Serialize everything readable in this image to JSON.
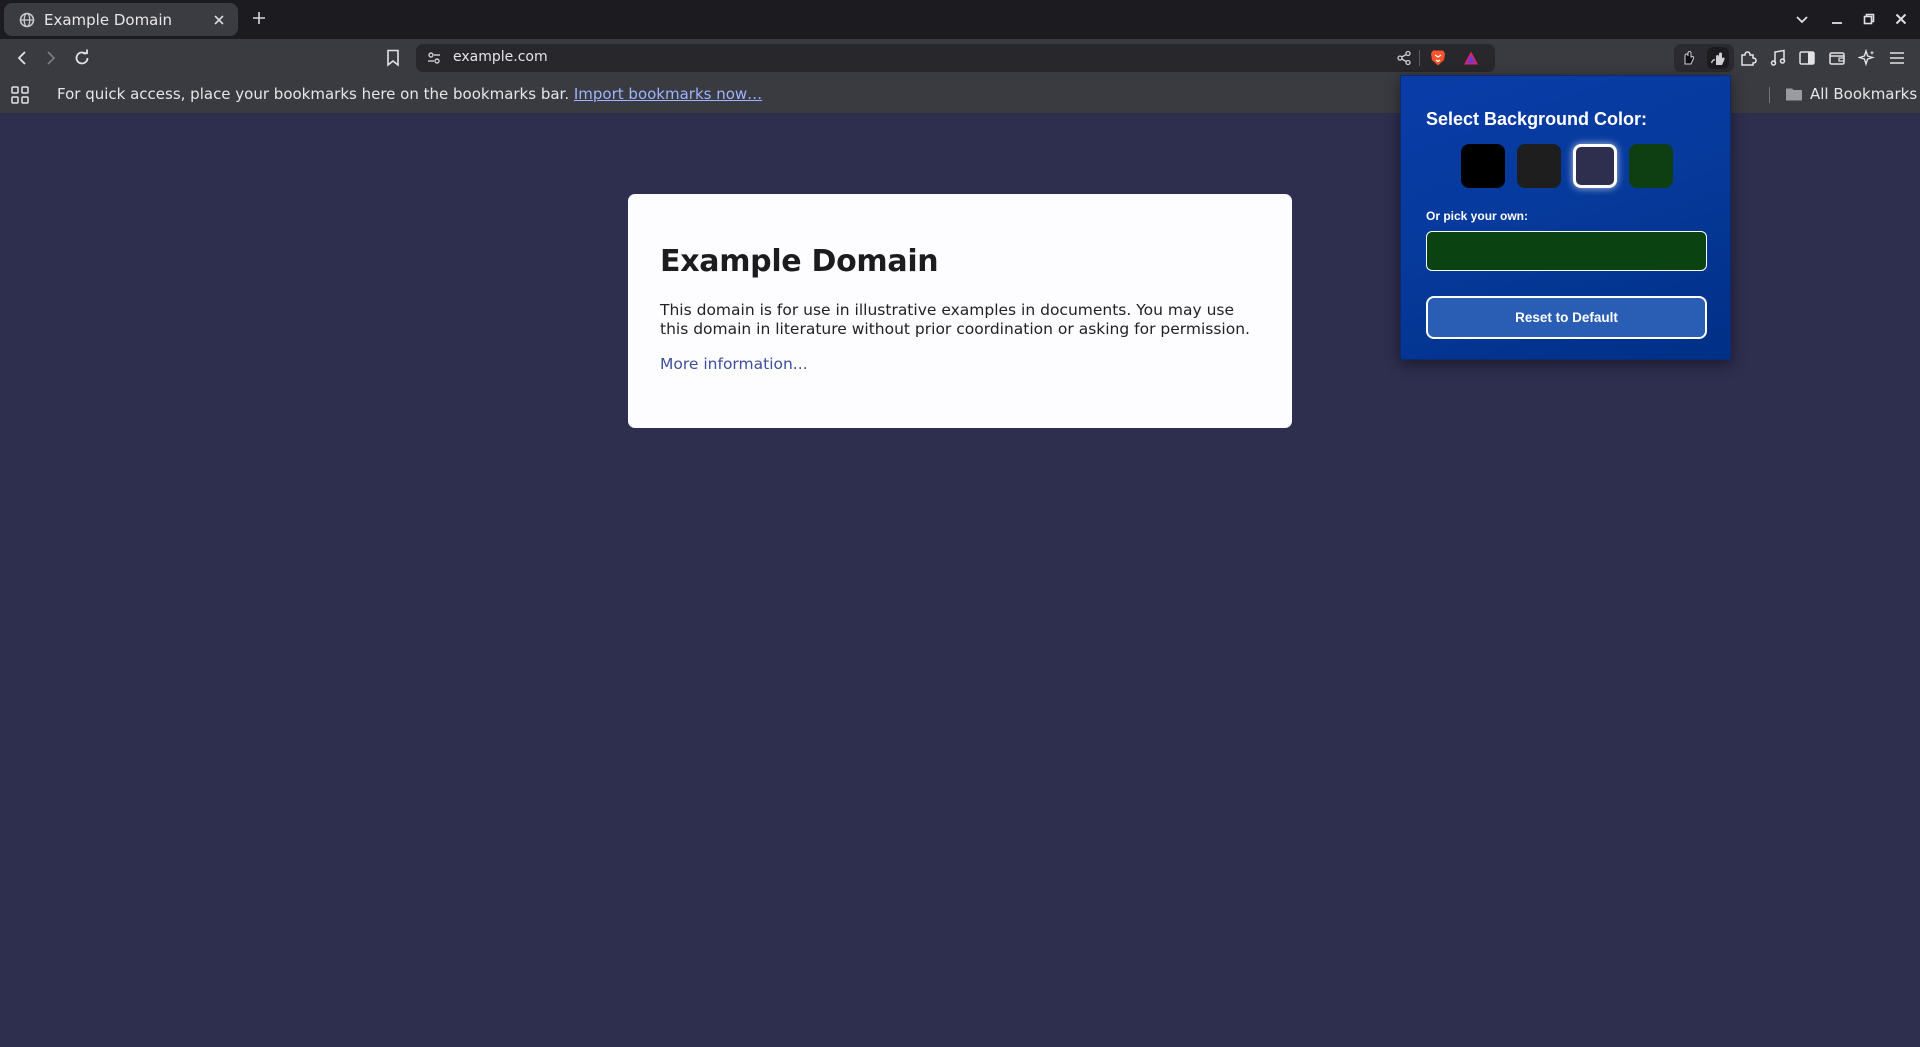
{
  "browser": {
    "tab": {
      "title": "Example Domain"
    },
    "address_bar": {
      "url": "example.com"
    },
    "bookmarks_bar": {
      "message": "For quick access, place your bookmarks here on the bookmarks bar.",
      "import_link": "Import bookmarks now…",
      "all_bookmarks": "All Bookmarks"
    }
  },
  "page": {
    "heading": "Example Domain",
    "paragraph": "This domain is for use in illustrative examples in documents. You may use this domain in literature without prior coordination or asking for permission.",
    "link": "More information..."
  },
  "popup": {
    "title": "Select Background Color:",
    "swatches": [
      {
        "name": "black",
        "color": "#000000"
      },
      {
        "name": "dark-gray",
        "color": "#1e1e1e"
      },
      {
        "name": "navy-slate",
        "color": "#2e2e4f",
        "selected": true
      },
      {
        "name": "dark-green",
        "color": "#0e3f13"
      }
    ],
    "custom_label": "Or pick your own:",
    "custom_color": "#0b4211",
    "reset_label": "Reset to Default"
  },
  "colors": {
    "page_background": "#2e2e4f",
    "popup_background": "#063a9c",
    "link": "#3f4f9c",
    "brave_lion": "#fb542b"
  }
}
